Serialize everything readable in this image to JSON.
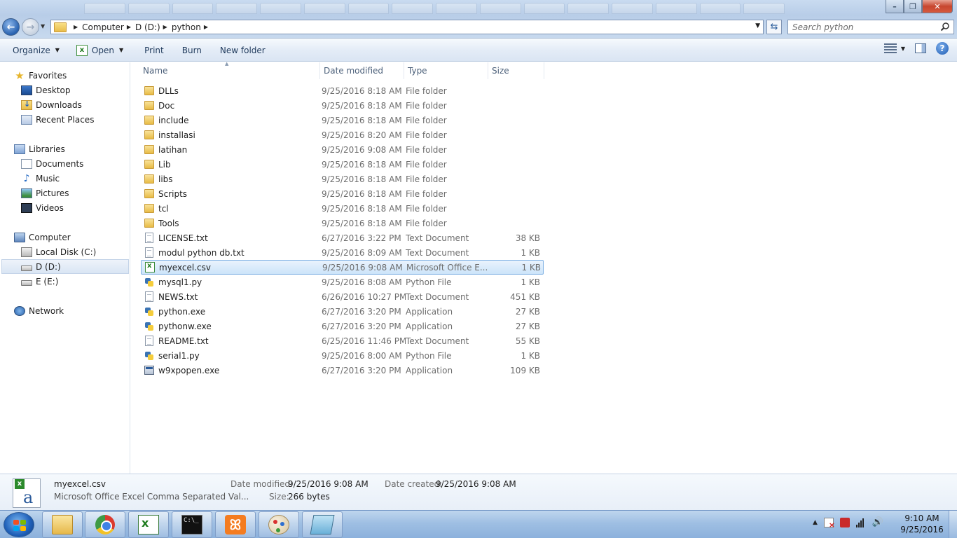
{
  "address": {
    "breadcrumbs": [
      "Computer",
      "D (D:)",
      "python"
    ],
    "search_placeholder": "Search python"
  },
  "toolbar": {
    "organize": "Organize",
    "open": "Open",
    "print": "Print",
    "burn": "Burn",
    "new_folder": "New folder"
  },
  "nav": {
    "favorites": "Favorites",
    "desktop": "Desktop",
    "downloads": "Downloads",
    "recent": "Recent Places",
    "libraries": "Libraries",
    "documents": "Documents",
    "music": "Music",
    "pictures": "Pictures",
    "videos": "Videos",
    "computer": "Computer",
    "local_c": "Local Disk (C:)",
    "drive_d": "D (D:)",
    "drive_e": "E (E:)",
    "network": "Network"
  },
  "columns": {
    "name": "Name",
    "date": "Date modified",
    "type": "Type",
    "size": "Size"
  },
  "files": [
    {
      "name": "DLLs",
      "date": "9/25/2016 8:18 AM",
      "type": "File folder",
      "size": "",
      "icon": "folder-icon"
    },
    {
      "name": "Doc",
      "date": "9/25/2016 8:18 AM",
      "type": "File folder",
      "size": "",
      "icon": "folder-icon"
    },
    {
      "name": "include",
      "date": "9/25/2016 8:18 AM",
      "type": "File folder",
      "size": "",
      "icon": "folder-icon"
    },
    {
      "name": "installasi",
      "date": "9/25/2016 8:20 AM",
      "type": "File folder",
      "size": "",
      "icon": "folder-icon"
    },
    {
      "name": "latihan",
      "date": "9/25/2016 9:08 AM",
      "type": "File folder",
      "size": "",
      "icon": "folder-icon"
    },
    {
      "name": "Lib",
      "date": "9/25/2016 8:18 AM",
      "type": "File folder",
      "size": "",
      "icon": "folder-icon"
    },
    {
      "name": "libs",
      "date": "9/25/2016 8:18 AM",
      "type": "File folder",
      "size": "",
      "icon": "folder-icon"
    },
    {
      "name": "Scripts",
      "date": "9/25/2016 8:18 AM",
      "type": "File folder",
      "size": "",
      "icon": "folder-icon"
    },
    {
      "name": "tcl",
      "date": "9/25/2016 8:18 AM",
      "type": "File folder",
      "size": "",
      "icon": "folder-icon"
    },
    {
      "name": "Tools",
      "date": "9/25/2016 8:18 AM",
      "type": "File folder",
      "size": "",
      "icon": "folder-icon"
    },
    {
      "name": "LICENSE.txt",
      "date": "6/27/2016 3:22 PM",
      "type": "Text Document",
      "size": "38 KB",
      "icon": "text-file-icon"
    },
    {
      "name": "modul python db.txt",
      "date": "9/25/2016 8:09 AM",
      "type": "Text Document",
      "size": "1 KB",
      "icon": "text-file-icon"
    },
    {
      "name": "myexcel.csv",
      "date": "9/25/2016 9:08 AM",
      "type": "Microsoft Office E...",
      "size": "1 KB",
      "icon": "excel-file-icon",
      "selected": true
    },
    {
      "name": "mysql1.py",
      "date": "9/25/2016 8:08 AM",
      "type": "Python File",
      "size": "1 KB",
      "icon": "python-file-icon"
    },
    {
      "name": "NEWS.txt",
      "date": "6/26/2016 10:27 PM",
      "type": "Text Document",
      "size": "451 KB",
      "icon": "text-file-icon"
    },
    {
      "name": "python.exe",
      "date": "6/27/2016 3:20 PM",
      "type": "Application",
      "size": "27 KB",
      "icon": "python-file-icon"
    },
    {
      "name": "pythonw.exe",
      "date": "6/27/2016 3:20 PM",
      "type": "Application",
      "size": "27 KB",
      "icon": "python-file-icon"
    },
    {
      "name": "README.txt",
      "date": "6/25/2016 11:46 PM",
      "type": "Text Document",
      "size": "55 KB",
      "icon": "text-file-icon"
    },
    {
      "name": "serial1.py",
      "date": "9/25/2016 8:00 AM",
      "type": "Python File",
      "size": "1 KB",
      "icon": "python-file-icon"
    },
    {
      "name": "w9xpopen.exe",
      "date": "6/27/2016 3:20 PM",
      "type": "Application",
      "size": "109 KB",
      "icon": "application-icon"
    }
  ],
  "details": {
    "name": "myexcel.csv",
    "type": "Microsoft Office Excel Comma Separated Val...",
    "modified_label": "Date modified:",
    "modified_value": "9/25/2016 9:08 AM",
    "created_label": "Date created:",
    "created_value": "9/25/2016 9:08 AM",
    "size_label": "Size:",
    "size_value": "266 bytes"
  },
  "taskbar": {
    "time": "9:10 AM",
    "date": "9/25/2016",
    "apps": [
      "windows-explorer-icon",
      "chrome-icon",
      "excel-icon",
      "command-prompt-icon",
      "xampp-icon",
      "paint-icon",
      "notepad-icon"
    ]
  }
}
